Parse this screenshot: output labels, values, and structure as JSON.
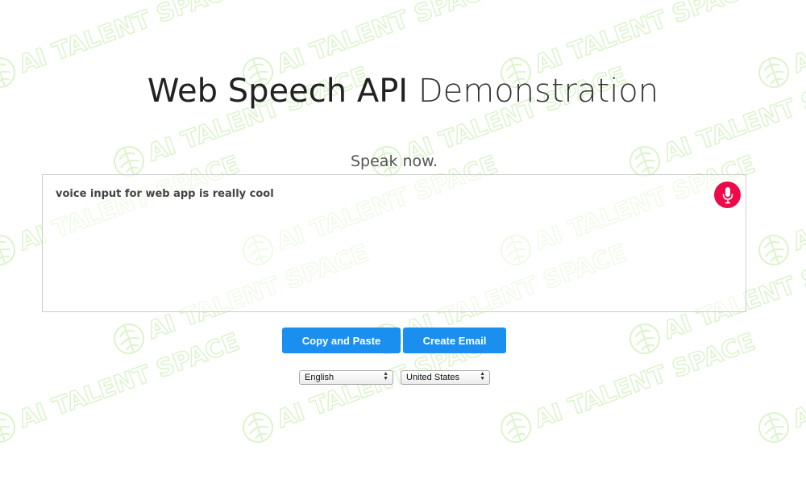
{
  "header": {
    "title_strong": "Web Speech API",
    "title_light": "Demonstration"
  },
  "status": {
    "text": "Speak now."
  },
  "results": {
    "transcript": "voice input for web app is really cool",
    "mic_icon": "microphone-icon",
    "mic_color": "#ee0a4a"
  },
  "buttons": {
    "copy_label": "Copy and Paste",
    "email_label": "Create Email",
    "color": "#1a8ff0"
  },
  "selects": {
    "language": "English",
    "dialect": "United States"
  },
  "watermark": {
    "text": "AI TALENT SPACE"
  }
}
